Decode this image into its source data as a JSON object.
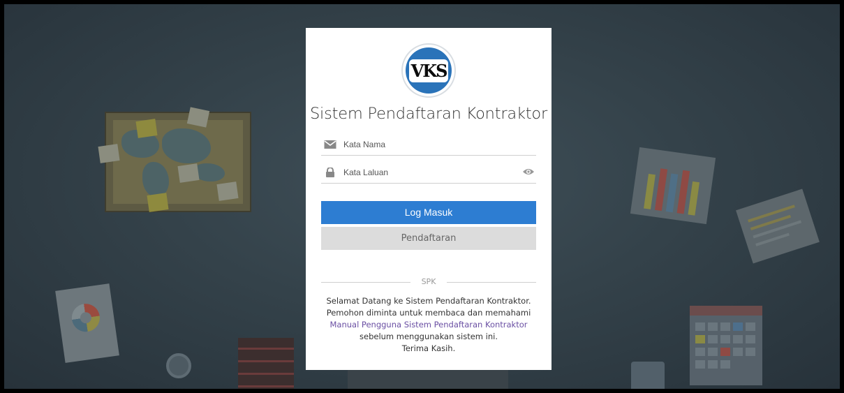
{
  "app": {
    "logo_text": "VKS",
    "title": "Sistem Pendaftaran Kontraktor"
  },
  "form": {
    "username_placeholder": "Kata Nama",
    "password_placeholder": "Kata Laluan",
    "login_label": "Log Masuk",
    "register_label": "Pendaftaran"
  },
  "footer": {
    "divider_label": "SPK",
    "line1": "Selamat Datang ke Sistem Pendaftaran Kontraktor.",
    "line2": "Pemohon diminta untuk membaca dan memahami",
    "manual_link": "Manual Pengguna Sistem Pendaftaran Kontraktor",
    "line3": "sebelum menggunakan sistem ini.",
    "line4": "Terima Kasih."
  },
  "icons": {
    "username": "envelope-icon",
    "password": "lock-icon",
    "show_password": "eye-icon"
  },
  "colors": {
    "primary": "#2d7dd2",
    "secondary": "#dcdcdc",
    "link": "#6a4fa3",
    "logo": "#2a73b9"
  }
}
